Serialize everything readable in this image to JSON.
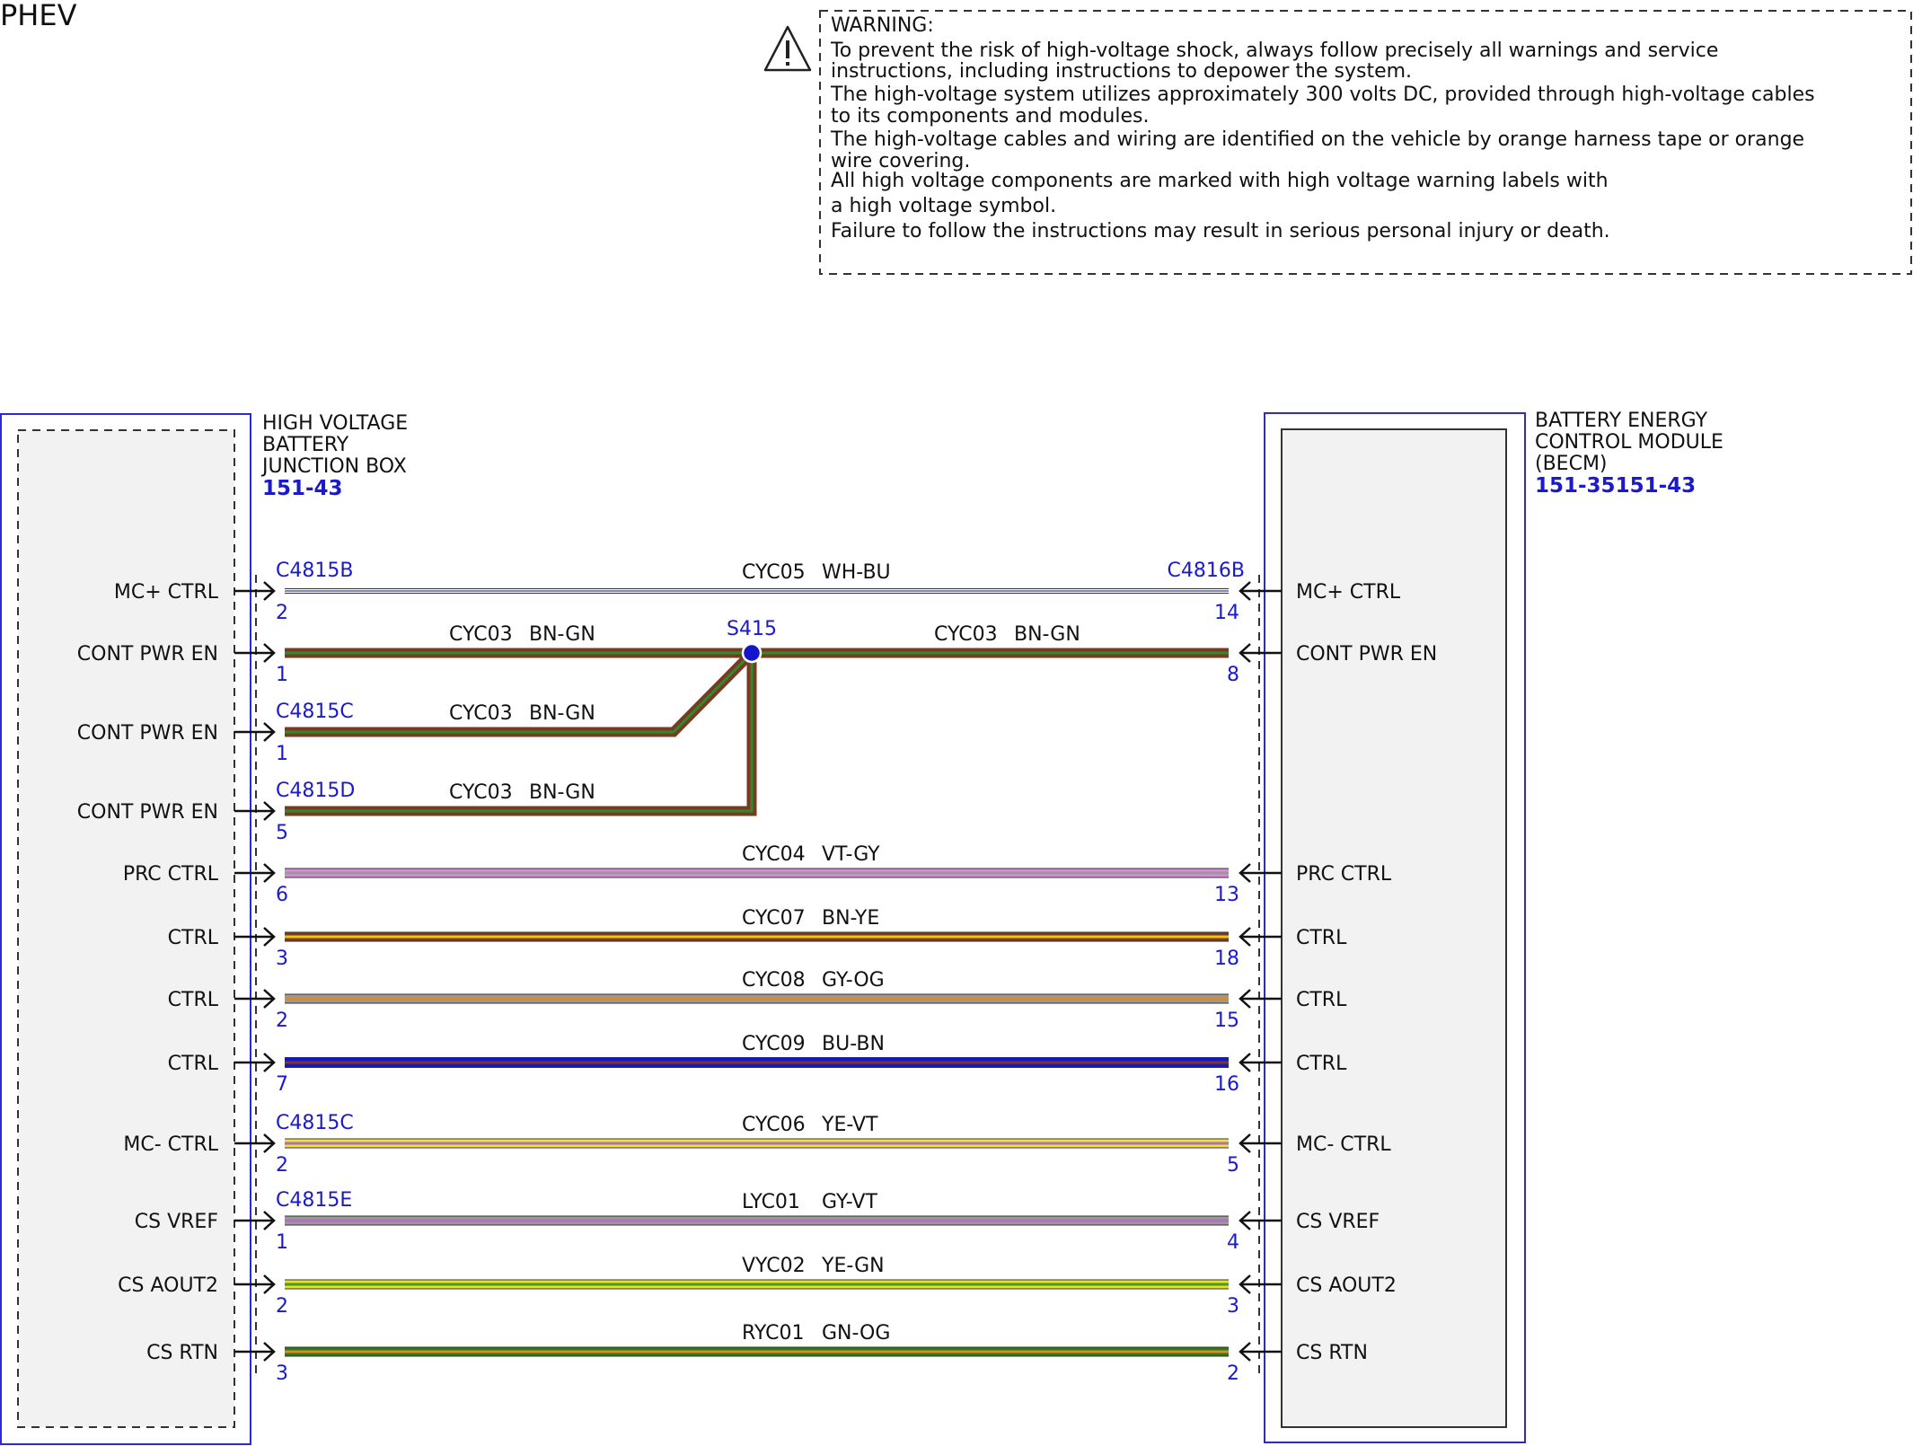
{
  "page_label": "PHEV",
  "warning": {
    "title": "WARNING:",
    "lines": [
      "To prevent the risk of high-voltage shock, always follow precisely all warnings and service",
      "instructions, including instructions to depower the system.",
      "The high-voltage system utilizes approximately 300 volts DC, provided through high-voltage cables",
      "to its components and modules.",
      "The high-voltage cables and wiring are identified on the vehicle by orange harness tape or orange",
      "wire covering.",
      "All high voltage components are marked with high voltage warning labels with",
      "a high voltage symbol.",
      "Failure to follow the instructions may result in serious personal injury or death."
    ]
  },
  "left_component": {
    "name_lines": [
      "HIGH VOLTAGE",
      "BATTERY",
      "JUNCTION BOX"
    ],
    "ref": "151-43"
  },
  "right_component": {
    "name_lines": [
      "BATTERY ENERGY",
      "CONTROL MODULE",
      "(BECM)"
    ],
    "ref": "151-35151-43"
  },
  "splice": {
    "label": "S415"
  },
  "colors": {
    "accent_blue": "#1a1acc",
    "component_border": "#2a2ad6",
    "component_fill": "#f2f2f2"
  },
  "circuits": [
    {
      "circuit": "CYC05",
      "color": "WH-BU",
      "left_pin_label": "MC+ CTRL",
      "left_pin": "2",
      "left_connector": "C4815B",
      "right_pin_label": "MC+ CTRL",
      "right_pin": "14",
      "right_connector": "C4816B",
      "c1": "#ffffff",
      "c2": "#4a5fd0"
    },
    {
      "circuit": "CYC03",
      "color": "BN-GN",
      "left_pin_label": "CONT PWR EN",
      "left_pin": "1",
      "left_connector": "",
      "right_pin_label": "CONT PWR EN",
      "right_pin": "8",
      "right_connector": "",
      "c1": "#7a3a22",
      "c2": "#2d8a2d",
      "splice": true
    },
    {
      "circuit": "CYC03",
      "color": "BN-GN",
      "left_pin_label": "CONT PWR EN",
      "left_pin": "1",
      "left_connector": "C4815C",
      "c1": "#7a3a22",
      "c2": "#2d8a2d"
    },
    {
      "circuit": "CYC03",
      "color": "BN-GN",
      "left_pin_label": "CONT PWR EN",
      "left_pin": "5",
      "left_connector": "C4815D",
      "c1": "#7a3a22",
      "c2": "#2d8a2d"
    },
    {
      "circuit": "CYC04",
      "color": "VT-GY",
      "left_pin_label": "PRC CTRL",
      "left_pin": "6",
      "left_connector": "",
      "right_pin_label": "PRC CTRL",
      "right_pin": "13",
      "right_connector": "",
      "c1": "#d98ad9",
      "c2": "#9a9a9a"
    },
    {
      "circuit": "CYC07",
      "color": "BN-YE",
      "left_pin_label": "CTRL",
      "left_pin": "3",
      "left_connector": "",
      "right_pin_label": "CTRL",
      "right_pin": "18",
      "right_connector": "",
      "c1": "#7a3a22",
      "c2": "#f0c800"
    },
    {
      "circuit": "CYC08",
      "color": "GY-OG",
      "left_pin_label": "CTRL",
      "left_pin": "2",
      "left_connector": "",
      "right_pin_label": "CTRL",
      "right_pin": "15",
      "right_connector": "",
      "c1": "#9a9a9a",
      "c2": "#e08a20"
    },
    {
      "circuit": "CYC09",
      "color": "BU-BN",
      "left_pin_label": "CTRL",
      "left_pin": "7",
      "left_connector": "",
      "right_pin_label": "CTRL",
      "right_pin": "16",
      "right_connector": "",
      "c1": "#1515cc",
      "c2": "#7a3a22"
    },
    {
      "circuit": "CYC06",
      "color": "YE-VT",
      "left_pin_label": "MC- CTRL",
      "left_pin": "2",
      "left_connector": "C4815C",
      "right_pin_label": "MC- CTRL",
      "right_pin": "5",
      "right_connector": "",
      "c1": "#f0e040",
      "c2": "#b070c0"
    },
    {
      "circuit": "LYC01",
      "color": "GY-VT",
      "left_pin_label": "CS VREF",
      "left_pin": "1",
      "left_connector": "C4815E",
      "right_pin_label": "CS VREF",
      "right_pin": "4",
      "right_connector": "",
      "c1": "#9a9a9a",
      "c2": "#b070c0"
    },
    {
      "circuit": "VYC02",
      "color": "YE-GN",
      "left_pin_label": "CS AOUT2",
      "left_pin": "2",
      "left_connector": "",
      "right_pin_label": "CS AOUT2",
      "right_pin": "3",
      "right_connector": "",
      "c1": "#e8e020",
      "c2": "#4a9a2a"
    },
    {
      "circuit": "RYC01",
      "color": "GN-OG",
      "left_pin_label": "CS RTN",
      "left_pin": "3",
      "left_connector": "",
      "right_pin_label": "CS RTN",
      "right_pin": "2",
      "right_connector": "",
      "c1": "#2d7a1d",
      "c2": "#e08a20"
    }
  ]
}
